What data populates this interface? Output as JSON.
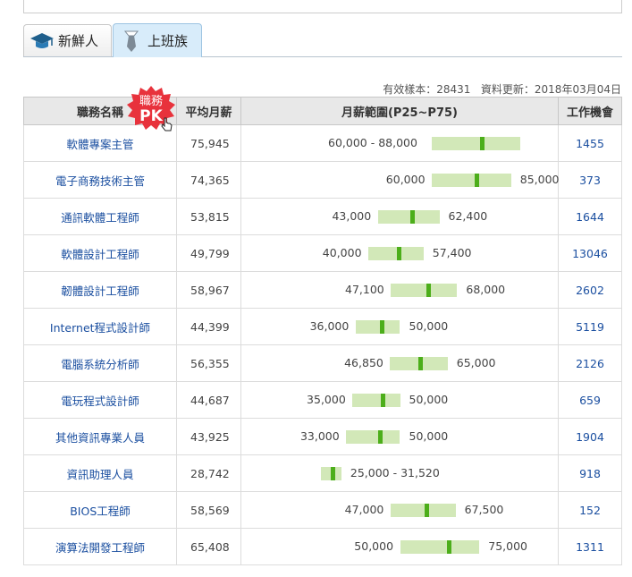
{
  "tabs": [
    {
      "label": "新鮮人",
      "icon": "graduation-cap-icon"
    },
    {
      "label": "上班族",
      "icon": "necktie-icon"
    }
  ],
  "meta": {
    "sample_label": "有效樣本",
    "sample": "28431",
    "update_label": "資料更新",
    "update": "2018年03月04日"
  },
  "pk_badge": {
    "line1": "職務",
    "line2": "PK"
  },
  "headers": {
    "name": "職務名稱",
    "avg": "平均月薪",
    "range": "月薪範圍(P25~P75)",
    "openings": "工作機會"
  },
  "chart_data": {
    "type": "table",
    "range_scale": [
      0,
      100000
    ],
    "rows": [
      {
        "name": "軟體專案主管",
        "avg": "75,945",
        "p25": 60000,
        "p75": 88000,
        "p25_label": "60,000",
        "p75_label": "88,000",
        "range_label": "60,000 - 88,000",
        "openings": "1455"
      },
      {
        "name": "電子商務技術主管",
        "avg": "74,365",
        "p25": 60000,
        "p75": 85000,
        "p25_label": "60,000",
        "p75_label": "85,000",
        "openings": "373"
      },
      {
        "name": "通訊軟體工程師",
        "avg": "53,815",
        "p25": 43000,
        "p75": 62400,
        "p25_label": "43,000",
        "p75_label": "62,400",
        "openings": "1644"
      },
      {
        "name": "軟體設計工程師",
        "avg": "49,799",
        "p25": 40000,
        "p75": 57400,
        "p25_label": "40,000",
        "p75_label": "57,400",
        "openings": "13046"
      },
      {
        "name": "韌體設計工程師",
        "avg": "58,967",
        "p25": 47100,
        "p75": 68000,
        "p25_label": "47,100",
        "p75_label": "68,000",
        "openings": "2602"
      },
      {
        "name": "Internet程式設計師",
        "avg": "44,399",
        "p25": 36000,
        "p75": 50000,
        "p25_label": "36,000",
        "p75_label": "50,000",
        "openings": "5119"
      },
      {
        "name": "電腦系統分析師",
        "avg": "56,355",
        "p25": 46850,
        "p75": 65000,
        "p25_label": "46,850",
        "p75_label": "65,000",
        "openings": "2126"
      },
      {
        "name": "電玩程式設計師",
        "avg": "44,687",
        "p25": 35000,
        "p75": 50000,
        "p25_label": "35,000",
        "p75_label": "50,000",
        "openings": "659"
      },
      {
        "name": "其他資訊專業人員",
        "avg": "43,925",
        "p25": 33000,
        "p75": 50000,
        "p25_label": "33,000",
        "p75_label": "50,000",
        "openings": "1904"
      },
      {
        "name": "資訊助理人員",
        "avg": "28,742",
        "p25": 25000,
        "p75": 31520,
        "p25_label": "25,000",
        "p75_label": "31,520",
        "range_label": "25,000 - 31,520",
        "openings": "918"
      },
      {
        "name": "BIOS工程師",
        "avg": "58,569",
        "p25": 47000,
        "p75": 67500,
        "p25_label": "47,000",
        "p75_label": "67,500",
        "openings": "152"
      },
      {
        "name": "演算法開發工程師",
        "avg": "65,408",
        "p25": 50000,
        "p75": 75000,
        "p25_label": "50,000",
        "p75_label": "75,000",
        "openings": "1311"
      }
    ]
  },
  "colors": {
    "link": "#1b4fa0",
    "bar": "#d2e8b8",
    "marker": "#4cae1a",
    "badge": "#e8323c"
  }
}
